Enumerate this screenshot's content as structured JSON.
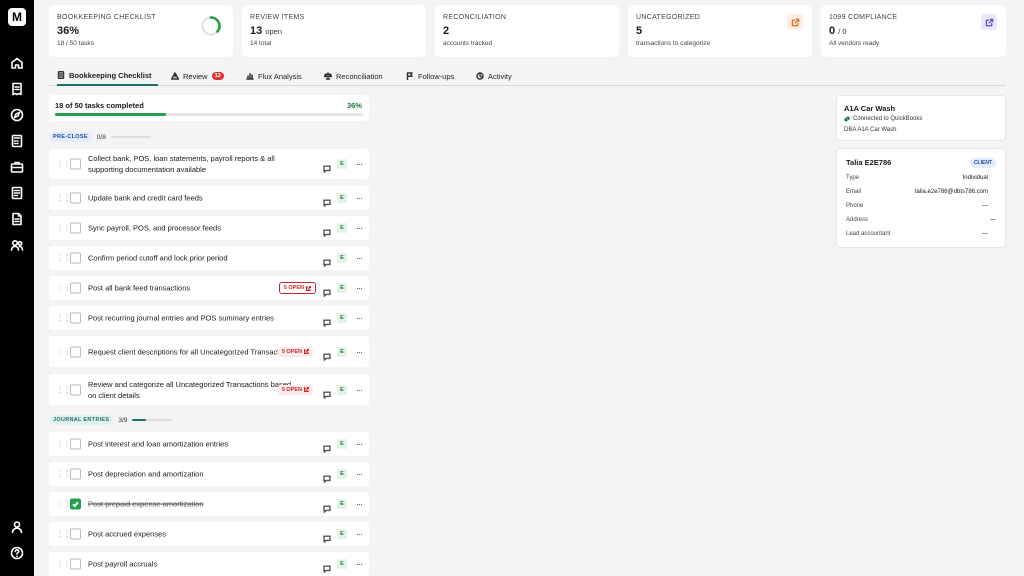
{
  "app": {
    "logo": "M"
  },
  "sidebar": {
    "icons": [
      "home-icon",
      "receipt-icon",
      "compass-icon",
      "calculator-icon",
      "briefcase-icon",
      "report-icon",
      "document-icon",
      "users-icon"
    ],
    "bottom_icons": [
      "user-icon",
      "help-icon"
    ]
  },
  "stats": [
    {
      "label": "BOOKKEEPING CHECKLIST",
      "value": "36%",
      "unit": "",
      "sub": "18 / 50 tasks",
      "progress": 0.36
    },
    {
      "label": "REVIEW ITEMS",
      "value": "13",
      "unit": "open",
      "sub": "14 total"
    },
    {
      "label": "RECONCILIATION",
      "value": "2",
      "unit": "",
      "sub": "accounts tracked"
    },
    {
      "label": "UNCATEGORIZED",
      "value": "5",
      "unit": "",
      "sub": "transactions to categorize"
    },
    {
      "label": "1099 COMPLIANCE",
      "value": "0",
      "unit": "/ 0",
      "sub": "All vendors ready"
    }
  ],
  "colors": {
    "accent": "#1d6f6a",
    "success": "#22a04a",
    "danger": "#c62828",
    "uncategorized_btn_bg": "#fdeee3",
    "uncategorized_btn_fg": "#e07020",
    "compliance_btn_bg": "#ece8fb",
    "compliance_btn_fg": "#6a4fd1"
  },
  "tabs": [
    {
      "label": "Bookkeeping Checklist",
      "icon": "checklist-icon",
      "active": true
    },
    {
      "label": "Review",
      "icon": "warning-icon",
      "badge": "13"
    },
    {
      "label": "Flux Analysis",
      "icon": "bar-chart-icon"
    },
    {
      "label": "Reconciliation",
      "icon": "scale-icon"
    },
    {
      "label": "Follow-ups",
      "icon": "flag-icon"
    },
    {
      "label": "Activity",
      "icon": "history-icon"
    }
  ],
  "progress": {
    "text": "18 of 50 tasks completed",
    "percent_label": "36%",
    "fraction": 0.36
  },
  "sections": [
    {
      "tag": "PRE-CLOSE",
      "count": "0/8",
      "fraction": 0,
      "tag_bg": "#e3ecfb",
      "tag_fg": "#1f4ea3",
      "tasks": [
        {
          "title": "Collect bank, POS, loan statements, payroll reports & all supporting documentation available",
          "e": "E"
        },
        {
          "title": "Update bank and credit card feeds",
          "e": "E"
        },
        {
          "title": "Sync payroll, POS, and processor feeds",
          "e": "E"
        },
        {
          "title": "Confirm period cutoff and lock prior period",
          "e": "E"
        },
        {
          "title": "Post all bank feed transactions",
          "badge": "5 OPEN",
          "badge_outlined": true,
          "e": "E"
        },
        {
          "title": "Post recurring journal entries and POS summary entries",
          "e": "E"
        },
        {
          "title": "Request client descriptions for all Uncategorized Transactions",
          "badge": "5 OPEN",
          "e": "E"
        },
        {
          "title": "Review and categorize all Uncategorized Transactions based on client details",
          "badge": "5 OPEN",
          "e": "E"
        }
      ]
    },
    {
      "tag": "JOURNAL ENTRIES",
      "count": "3/9",
      "fraction": 0.333,
      "tag_bg": "#e0f2ef",
      "tag_fg": "#1d6f6a",
      "tasks": [
        {
          "title": "Post interest and loan amortization entries",
          "e": "E"
        },
        {
          "title": "Post depreciation and amortization",
          "e": "E"
        },
        {
          "title": "Post prepaid expense amortization",
          "done": true,
          "e": "E"
        },
        {
          "title": "Post accrued expenses",
          "e": "E"
        },
        {
          "title": "Post payroll accruals",
          "e": "E"
        }
      ]
    }
  ],
  "company": {
    "name": "A1A Car Wash",
    "connection": "Connected to QuickBooks",
    "dba": "DBA A1A Car Wash"
  },
  "client": {
    "name": "Talia E2E786",
    "badge": "CLIENT",
    "fields": [
      {
        "key": "Type",
        "value": "Individual"
      },
      {
        "key": "Email",
        "value": "talia.e2e786@dbts786.com"
      },
      {
        "key": "Phone",
        "value": "—"
      },
      {
        "key": "Address",
        "value": "—"
      },
      {
        "key": "Lead accountant",
        "value": "—"
      }
    ]
  }
}
